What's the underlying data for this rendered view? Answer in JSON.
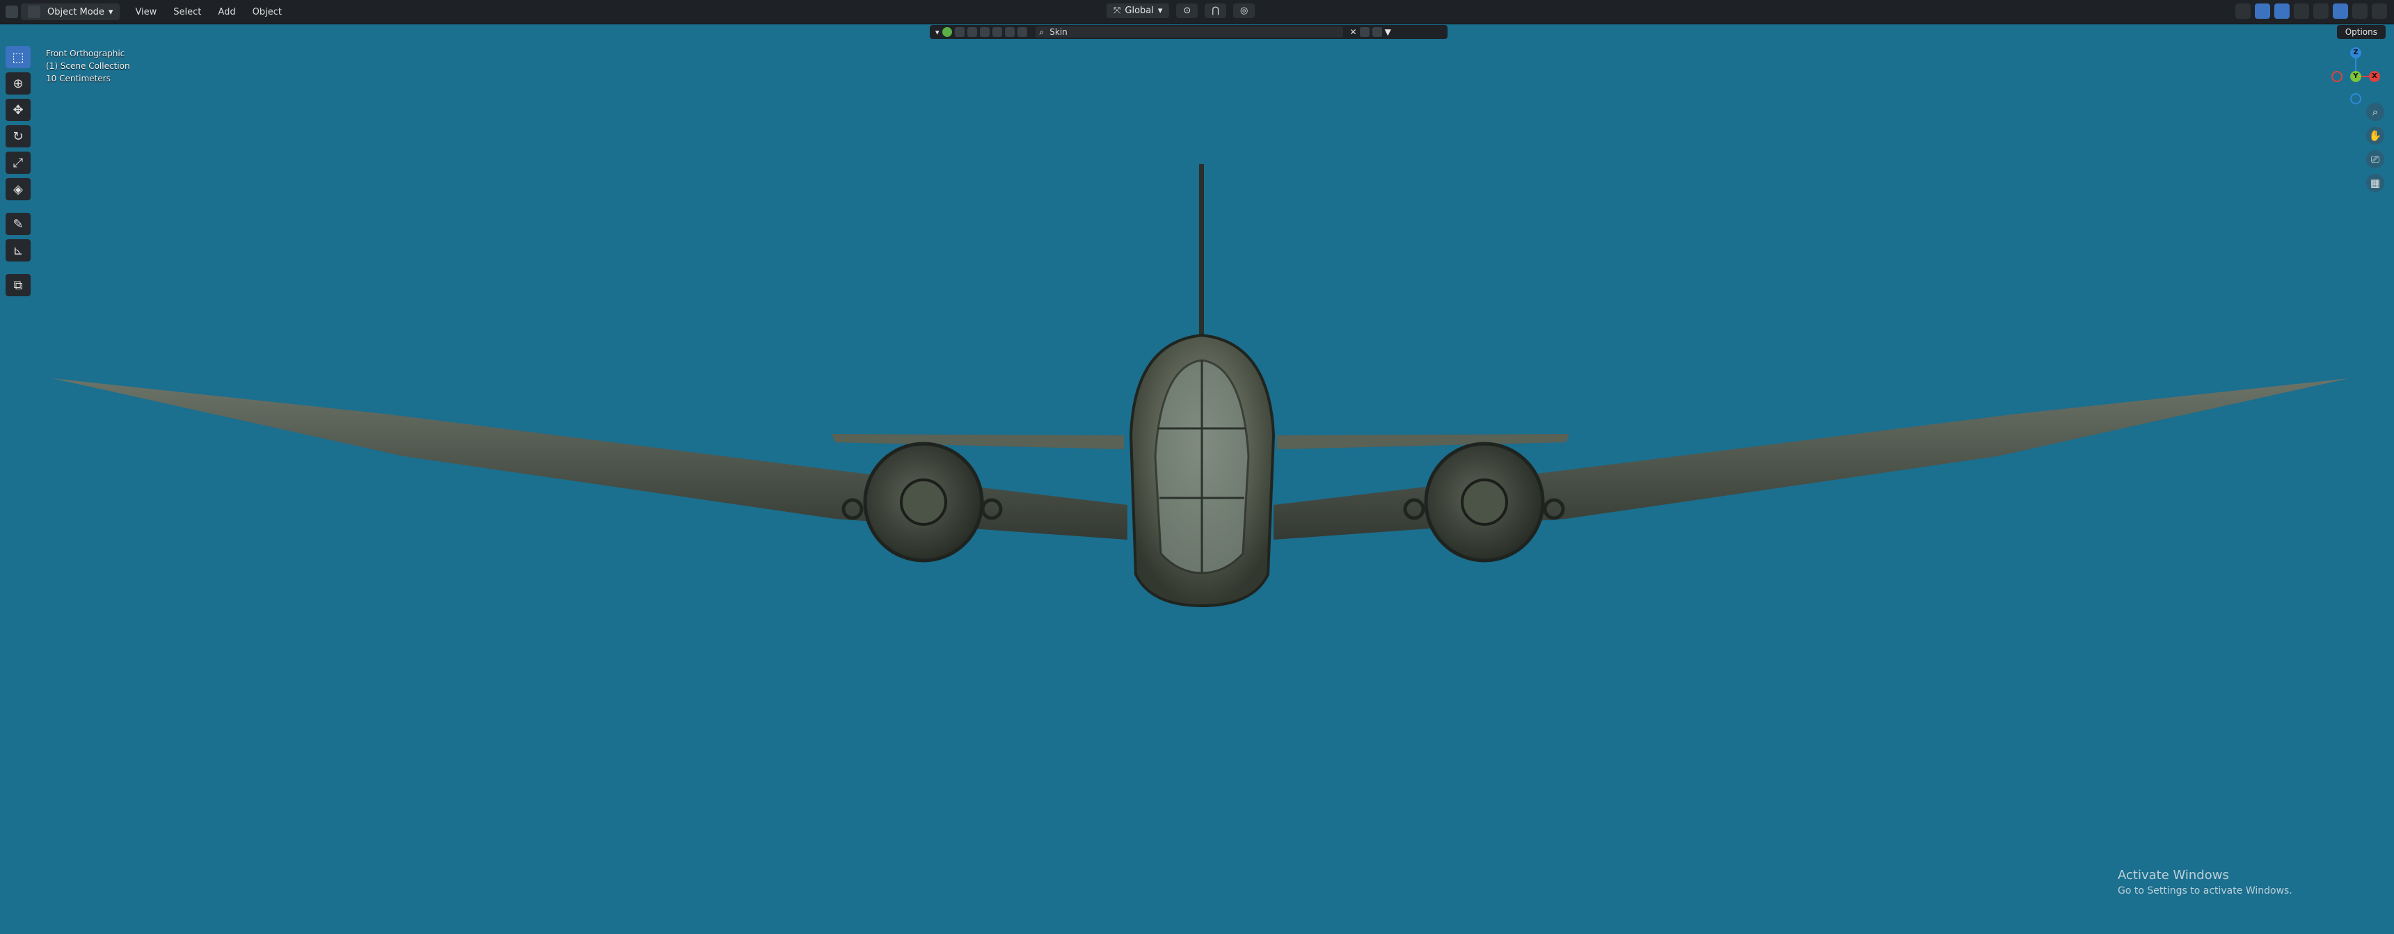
{
  "header": {
    "mode_label": "Object Mode",
    "menus": [
      "View",
      "Select",
      "Add",
      "Object"
    ],
    "transform_orientation": "Global"
  },
  "outliner_filter": {
    "search_value": "Skin"
  },
  "options_label": "Options",
  "viewport_info": {
    "view_name": "Front Orthographic",
    "collection": "(1) Scene Collection",
    "scale": "10 Centimeters"
  },
  "gizmo": {
    "z": "Z",
    "y": "Y",
    "x": "X"
  },
  "watermark": {
    "title": "Activate Windows",
    "subtitle": "Go to Settings to activate Windows."
  },
  "colors": {
    "viewport_background": "#1b6f8f",
    "active_tool": "#3c73c0",
    "axis_x": "#e0413b",
    "axis_y": "#7cc43a",
    "axis_z": "#2f88d8"
  },
  "icons": {
    "tools": [
      "select-box-icon",
      "cursor-icon",
      "move-icon",
      "rotate-icon",
      "scale-icon",
      "transform-icon",
      "annotate-icon",
      "measure-icon",
      "add-cube-icon"
    ],
    "nav": [
      "zoom-icon",
      "hand-pan-icon",
      "camera-icon",
      "grid-icon"
    ]
  }
}
